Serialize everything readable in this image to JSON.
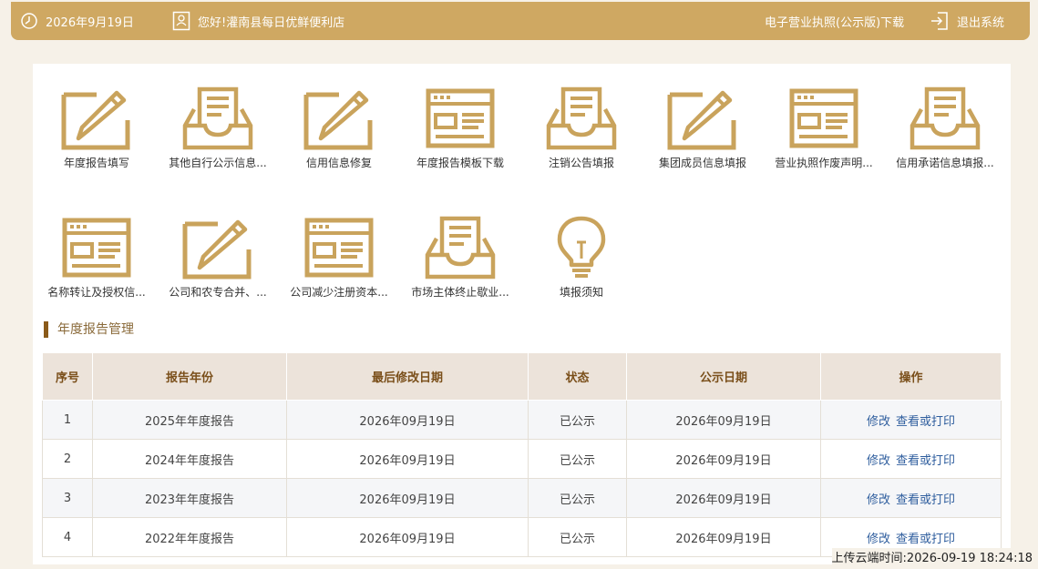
{
  "header": {
    "date": "2026年9月19日",
    "greeting": "您好!灌南县每日优鲜便利店",
    "license_link": "电子营业执照(公示版)下载",
    "logout": "退出系统"
  },
  "tiles": [
    {
      "label": "年度报告填写",
      "icon": "pencil-doc"
    },
    {
      "label": "其他自行公示信息...",
      "icon": "inbox"
    },
    {
      "label": "信用信息修复",
      "icon": "pencil-doc"
    },
    {
      "label": "年度报告模板下载",
      "icon": "window"
    },
    {
      "label": "注销公告填报",
      "icon": "inbox"
    },
    {
      "label": "集团成员信息填报",
      "icon": "pencil-doc"
    },
    {
      "label": "营业执照作废声明...",
      "icon": "window"
    },
    {
      "label": "信用承诺信息填报...",
      "icon": "inbox"
    },
    {
      "label": "名称转让及授权信...",
      "icon": "window"
    },
    {
      "label": "公司和农专合并、...",
      "icon": "pencil-doc"
    },
    {
      "label": "公司减少注册资本...",
      "icon": "window"
    },
    {
      "label": "市场主体终止歇业...",
      "icon": "inbox"
    },
    {
      "label": "填报须知",
      "icon": "bulb"
    }
  ],
  "section": {
    "title": "年度报告管理"
  },
  "table": {
    "headers": [
      "序号",
      "报告年份",
      "最后修改日期",
      "状态",
      "公示日期",
      "操作"
    ],
    "rows": [
      {
        "no": "1",
        "year": "2025年年度报告",
        "modified": "2026年09月19日",
        "status": "已公示",
        "publish": "2026年09月19日",
        "edit": "修改",
        "view": "查看或打印"
      },
      {
        "no": "2",
        "year": "2024年年度报告",
        "modified": "2026年09月19日",
        "status": "已公示",
        "publish": "2026年09月19日",
        "edit": "修改",
        "view": "查看或打印"
      },
      {
        "no": "3",
        "year": "2023年年度报告",
        "modified": "2026年09月19日",
        "status": "已公示",
        "publish": "2026年09月19日",
        "edit": "修改",
        "view": "查看或打印"
      },
      {
        "no": "4",
        "year": "2022年年度报告",
        "modified": "2026年09月19日",
        "status": "已公示",
        "publish": "2026年09月19日",
        "edit": "修改",
        "view": "查看或打印"
      }
    ]
  },
  "footer": {
    "upload_time": "上传云端时间:2026-09-19 18:24:18"
  },
  "colors": {
    "accent": "#cfa862",
    "icon": "#c9a35c",
    "link": "#2f5e9e"
  }
}
